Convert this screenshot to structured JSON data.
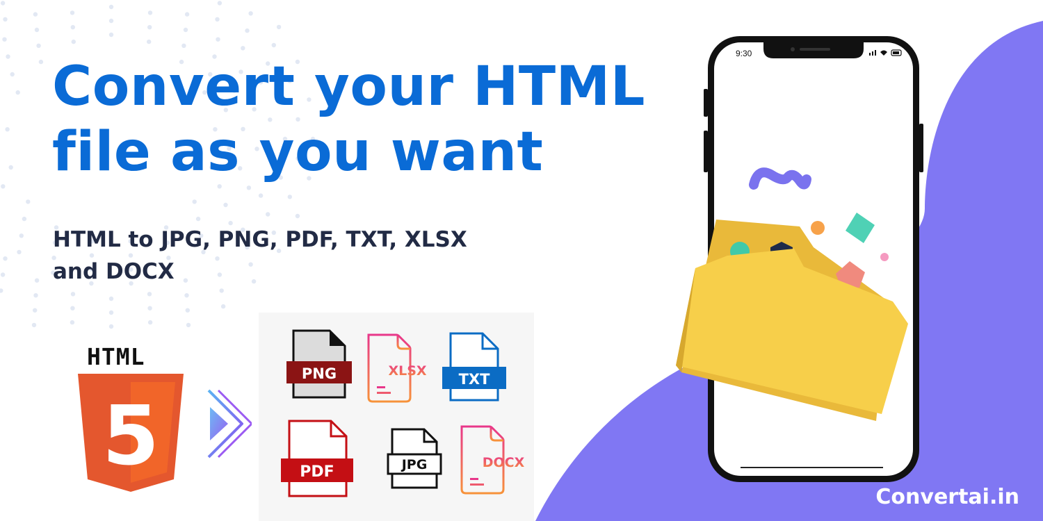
{
  "headline": {
    "line1": "Convert your HTML",
    "line2": "file as you want"
  },
  "subheadline": {
    "line1": "HTML to JPG, PNG, PDF, TXT, XLSX",
    "line2": "and DOCX"
  },
  "source_format": {
    "label": "HTML",
    "badge_digit": "5"
  },
  "target_formats": [
    {
      "label": "PNG",
      "icon": "png-file-icon"
    },
    {
      "label": "XLSX",
      "icon": "xlsx-file-icon"
    },
    {
      "label": "TXT",
      "icon": "txt-file-icon"
    },
    {
      "label": "PDF",
      "icon": "pdf-file-icon"
    },
    {
      "label": "JPG",
      "icon": "jpg-file-icon"
    },
    {
      "label": "DOCX",
      "icon": "docx-file-icon"
    }
  ],
  "phone": {
    "time": "9:30"
  },
  "brand": "Convertai.in",
  "colors": {
    "headline": "#0a6bd6",
    "subheadline": "#222b45",
    "wave": "#8077f3",
    "folder": "#f7cf4a",
    "html5_orange": "#e4572e",
    "png_red": "#8b1414",
    "pdf_red": "#c40f14",
    "txt_blue": "#0b6cc4",
    "gradient_start": "#e8378a",
    "gradient_end": "#f7923a"
  }
}
